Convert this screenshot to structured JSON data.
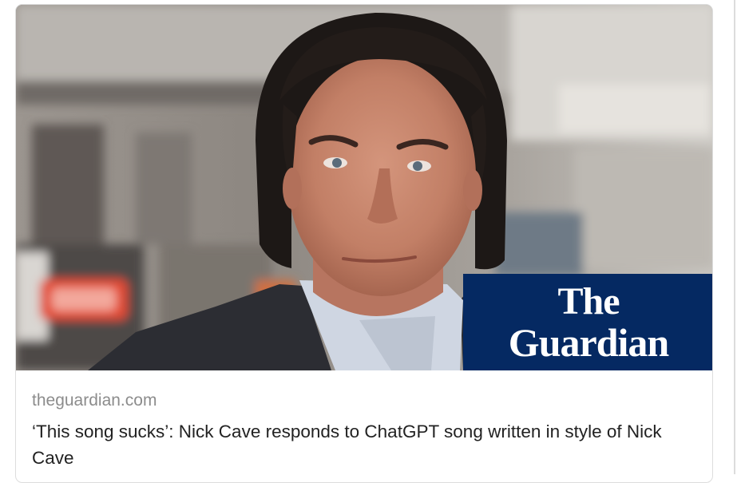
{
  "link_card": {
    "domain": "theguardian.com",
    "headline": "‘This song sucks’: Nick Cave responds to ChatGPT song written in style of Nick Cave",
    "logo": {
      "line1": "The",
      "line2": "Guardian",
      "background": "#052962",
      "text_color": "#ffffff"
    }
  },
  "colors": {
    "domain_text": "#8c8c8c",
    "headline_text": "#222222",
    "card_border": "#dddddd"
  }
}
